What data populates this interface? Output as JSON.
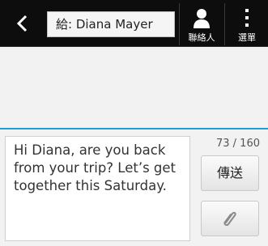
{
  "header": {
    "recipient": "給: Diana Mayer",
    "contacts_label": "聯絡人",
    "menu_label": "選單",
    "icons": {
      "back": "back-chevron-icon",
      "contacts": "person-icon",
      "menu": "overflow-menu-icon"
    }
  },
  "composer": {
    "message": "Hi Diana, are you back from your trip? Let’s get together this Saturday.",
    "char_counter": "73 / 160",
    "send_label": "傳送",
    "attach_icon": "paperclip-icon",
    "accent_color": "#1a9fd8"
  }
}
